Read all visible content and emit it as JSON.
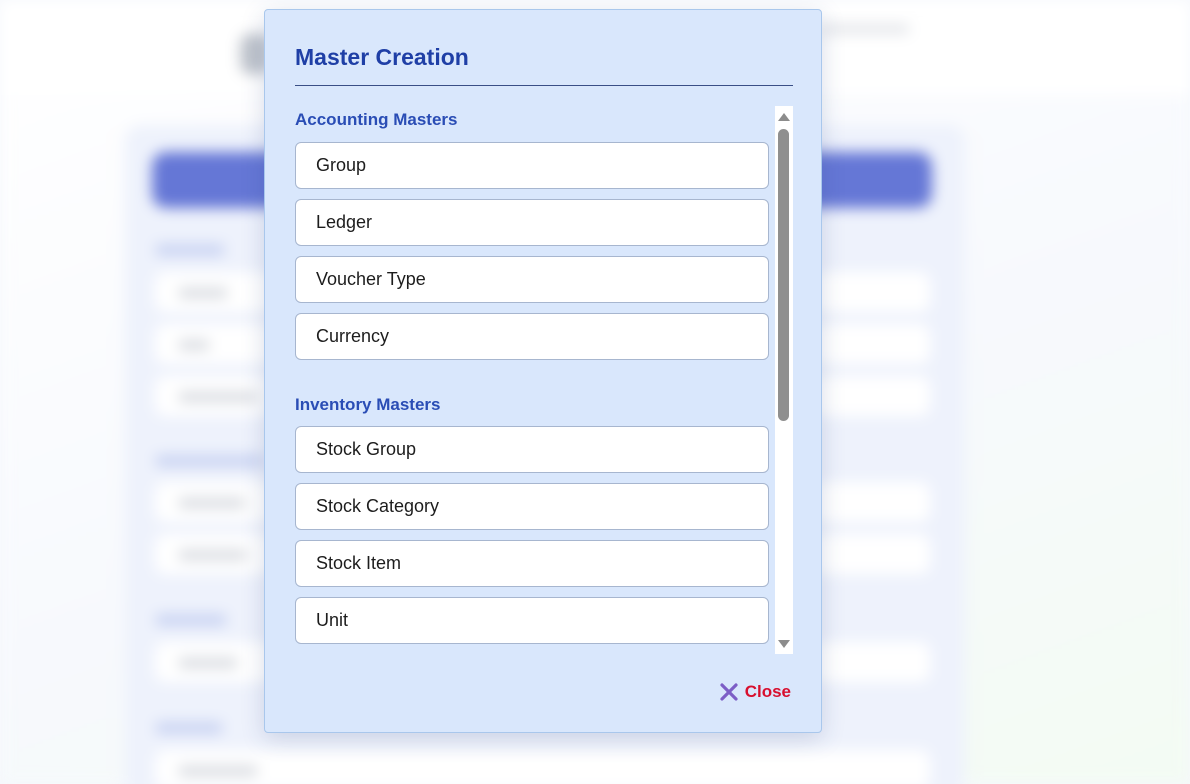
{
  "modal": {
    "title": "Master Creation",
    "sections": [
      {
        "title": "Accounting Masters",
        "items": [
          "Group",
          "Ledger",
          "Voucher Type",
          "Currency"
        ]
      },
      {
        "title": "Inventory Masters",
        "items": [
          "Stock Group",
          "Stock Category",
          "Stock Item",
          "Unit",
          ""
        ]
      }
    ],
    "close_label": "Close",
    "close_icon": "x-icon",
    "colors": {
      "title": "#1f3fa6",
      "section_title": "#2a4db5",
      "close": "#d80f2e",
      "close_icon": "#7c5ec6",
      "modal_bg": "#d9e7fc"
    }
  }
}
